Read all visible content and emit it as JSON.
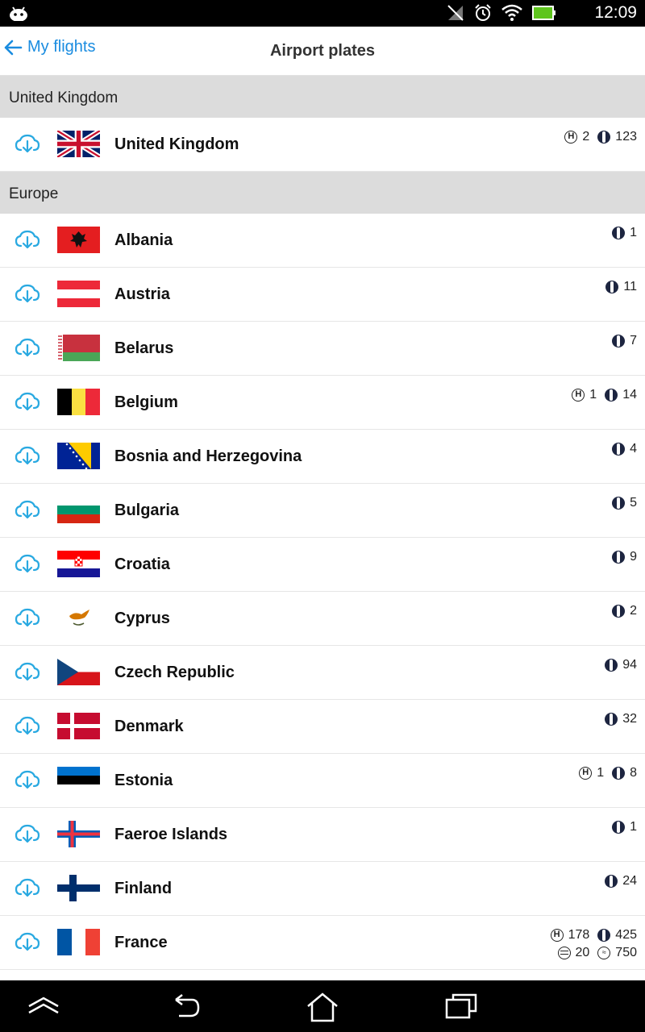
{
  "status": {
    "time": "12:09"
  },
  "header": {
    "back_label": "My flights",
    "title": "Airport plates"
  },
  "sections": [
    {
      "title": "United Kingdom",
      "rows": [
        {
          "name": "United Kingdom",
          "flag": "uk",
          "stats": [
            [
              {
                "icon": "h",
                "value": "2"
              },
              {
                "icon": "o",
                "value": "123"
              }
            ]
          ]
        }
      ]
    },
    {
      "title": "Europe",
      "rows": [
        {
          "name": "Albania",
          "flag": "albania",
          "stats": [
            [
              {
                "icon": "o",
                "value": "1"
              }
            ]
          ]
        },
        {
          "name": "Austria",
          "flag": "austria",
          "stats": [
            [
              {
                "icon": "o",
                "value": "11"
              }
            ]
          ]
        },
        {
          "name": "Belarus",
          "flag": "belarus",
          "stats": [
            [
              {
                "icon": "o",
                "value": "7"
              }
            ]
          ]
        },
        {
          "name": "Belgium",
          "flag": "belgium",
          "stats": [
            [
              {
                "icon": "h",
                "value": "1"
              },
              {
                "icon": "o",
                "value": "14"
              }
            ]
          ]
        },
        {
          "name": "Bosnia and Herzegovina",
          "flag": "bosnia",
          "stats": [
            [
              {
                "icon": "o",
                "value": "4"
              }
            ]
          ]
        },
        {
          "name": "Bulgaria",
          "flag": "bulgaria",
          "stats": [
            [
              {
                "icon": "o",
                "value": "5"
              }
            ]
          ]
        },
        {
          "name": "Croatia",
          "flag": "croatia",
          "stats": [
            [
              {
                "icon": "o",
                "value": "9"
              }
            ]
          ]
        },
        {
          "name": "Cyprus",
          "flag": "cyprus",
          "stats": [
            [
              {
                "icon": "o",
                "value": "2"
              }
            ]
          ]
        },
        {
          "name": "Czech Republic",
          "flag": "czech",
          "stats": [
            [
              {
                "icon": "o",
                "value": "94"
              }
            ]
          ]
        },
        {
          "name": "Denmark",
          "flag": "denmark",
          "stats": [
            [
              {
                "icon": "o",
                "value": "32"
              }
            ]
          ]
        },
        {
          "name": "Estonia",
          "flag": "estonia",
          "stats": [
            [
              {
                "icon": "h",
                "value": "1"
              },
              {
                "icon": "o",
                "value": "8"
              }
            ]
          ]
        },
        {
          "name": "Faeroe Islands",
          "flag": "faroe",
          "stats": [
            [
              {
                "icon": "o",
                "value": "1"
              }
            ]
          ]
        },
        {
          "name": "Finland",
          "flag": "finland",
          "stats": [
            [
              {
                "icon": "o",
                "value": "24"
              }
            ]
          ]
        },
        {
          "name": "France",
          "flag": "france",
          "stats": [
            [
              {
                "icon": "h",
                "value": "178"
              },
              {
                "icon": "o",
                "value": "425"
              }
            ],
            [
              {
                "icon": "eq",
                "value": "20"
              },
              {
                "icon": "w",
                "value": "750"
              }
            ]
          ]
        }
      ]
    }
  ],
  "colors": {
    "accent": "#1a8ce0",
    "cloud": "#29a9e1",
    "section_bg": "#dcdcdc"
  }
}
